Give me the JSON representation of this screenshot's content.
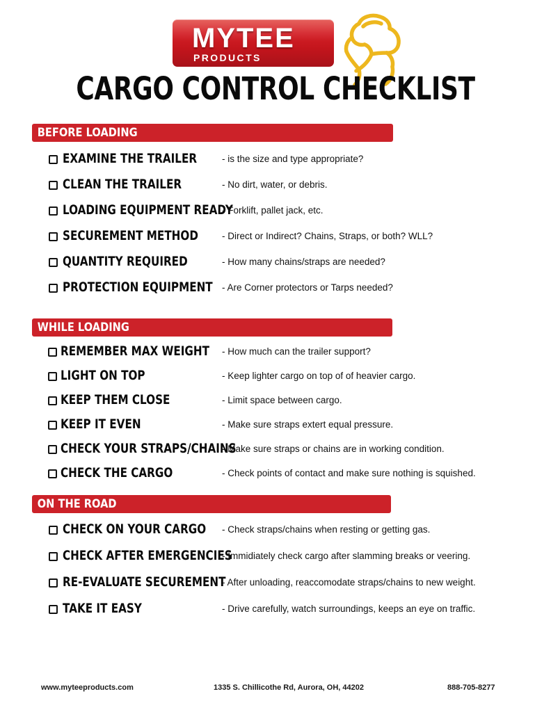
{
  "brand": {
    "logo_primary": "MYTEE",
    "logo_secondary": "PRODUCTS",
    "mascot_icon": "flexing-arm-mascot-icon",
    "accent_red": "#CC2229",
    "logo_red": "#D42027",
    "mascot_gold": "#E8B battalion"
  },
  "title": "CARGO CONTROL CHECKLIST",
  "sections": [
    {
      "heading": "BEFORE LOADING",
      "items": [
        {
          "label": "EXAMINE THE TRAILER",
          "desc": "- is the size and type appropriate?"
        },
        {
          "label": "CLEAN THE TRAILER",
          "desc": "- No dirt, water, or debris."
        },
        {
          "label": "LOADING EQUIPMENT READY",
          "desc": "- Forklift, pallet jack, etc."
        },
        {
          "label": "SECUREMENT METHOD",
          "desc": "- Direct or Indirect? Chains, Straps, or both? WLL?"
        },
        {
          "label": "QUANTITY REQUIRED",
          "desc": "- How many chains/straps are needed?"
        },
        {
          "label": "PROTECTION EQUIPMENT",
          "desc": "- Are Corner protectors or Tarps needed?"
        }
      ]
    },
    {
      "heading": "WHILE LOADING",
      "items": [
        {
          "label": "REMEMBER MAX WEIGHT",
          "desc": "- How much can the trailer support?"
        },
        {
          "label": "LIGHT ON TOP",
          "desc": "- Keep lighter cargo on top of of heavier cargo."
        },
        {
          "label": "KEEP THEM CLOSE",
          "desc": "- Limit space between cargo."
        },
        {
          "label": "KEEP IT EVEN",
          "desc": "- Make sure straps extert equal pressure."
        },
        {
          "label": "CHECK YOUR STRAPS/CHAINS",
          "desc": "- Make sure straps or chains are in working condition."
        },
        {
          "label": "CHECK THE CARGO",
          "desc": "- Check points of contact and make sure nothing is squished."
        }
      ]
    },
    {
      "heading": "ON THE ROAD",
      "items": [
        {
          "label": "CHECK ON YOUR CARGO",
          "desc": "- Check straps/chains when resting or getting gas."
        },
        {
          "label": "CHECK AFTER EMERGENCIES",
          "desc": "- Immidiately check cargo after slamming breaks or veering."
        },
        {
          "label": "RE-EVALUATE SECUREMENT",
          "desc": "- After unloading, reaccomodate straps/chains to new weight."
        },
        {
          "label": "TAKE IT EASY",
          "desc": "- Drive carefully, watch surroundings, keeps an eye on traffic."
        }
      ]
    }
  ],
  "footer": {
    "website": "www.myteeproducts.com",
    "address": "1335 S. Chillicothe Rd, Aurora, OH, 44202",
    "phone": "888-705-8277"
  }
}
